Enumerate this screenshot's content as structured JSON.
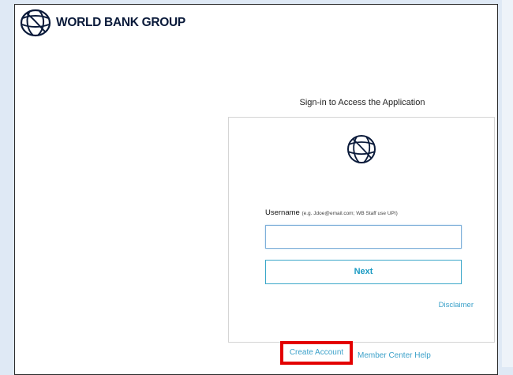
{
  "header": {
    "logo_text": "WORLD BANK GROUP",
    "logo_icon": "globe-logo-icon"
  },
  "signin": {
    "title": "Sign-in to Access the Application",
    "username_label": "Username",
    "username_hint": "(e.g. Jdoe@email.com; WB Staff use UPI)",
    "username_value": "",
    "next_label": "Next",
    "disclaimer_label": "Disclaimer"
  },
  "footer": {
    "create_account_label": "Create Account",
    "member_help_label": "Member Center Help"
  },
  "colors": {
    "brand_navy": "#0a1a3a",
    "link_blue": "#3aa0c9",
    "highlight_red": "#e30000",
    "page_background": "#dfe9f5"
  }
}
